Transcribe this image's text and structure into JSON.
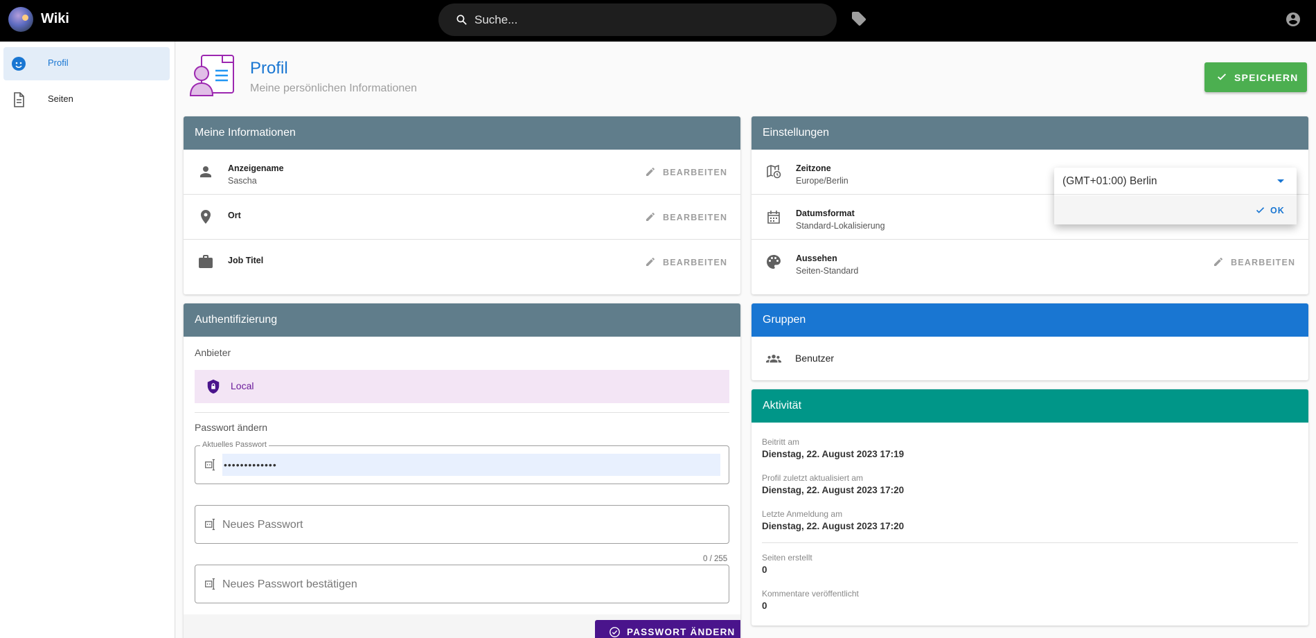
{
  "app": {
    "title": "Wiki"
  },
  "search": {
    "placeholder": "Suche..."
  },
  "sidebar": {
    "items": [
      {
        "label": "Profil",
        "icon": "face-icon",
        "active": true
      },
      {
        "label": "Seiten",
        "icon": "document-icon",
        "active": false
      }
    ]
  },
  "header": {
    "title": "Profil",
    "subtitle": "Meine persönlichen Informationen",
    "save_label": "SPEICHERN"
  },
  "info": {
    "title": "Meine Informationen",
    "edit_label": "BEARBEITEN",
    "rows": [
      {
        "label": "Anzeigename",
        "value": "Sascha",
        "icon": "person-icon"
      },
      {
        "label": "Ort",
        "value": "",
        "icon": "location-pin-icon"
      },
      {
        "label": "Job Titel",
        "value": "",
        "icon": "briefcase-icon"
      }
    ]
  },
  "auth": {
    "title": "Authentifizierung",
    "provider_label": "Anbieter",
    "provider_value": "Local",
    "change_label": "Passwort ändern",
    "current_legend": "Aktuelles Passwort",
    "current_value": "•••••••••••••",
    "new_placeholder": "Neues Passwort",
    "counter": "0 / 255",
    "confirm_placeholder": "Neues Passwort bestätigen",
    "button_label": "PASSWORT ÄNDERN"
  },
  "settings": {
    "title": "Einstellungen",
    "edit_label": "BEARBEITEN",
    "rows": [
      {
        "label": "Zeitzone",
        "value": "Europe/Berlin",
        "icon": "map-clock-icon"
      },
      {
        "label": "Datumsformat",
        "value": "Standard-Lokalisierung",
        "icon": "calendar-icon"
      },
      {
        "label": "Aussehen",
        "value": "Seiten-Standard",
        "icon": "palette-icon"
      }
    ],
    "timezone_popup": {
      "selected": "(GMT+01:00) Berlin",
      "ok_label": "OK"
    }
  },
  "groups": {
    "title": "Gruppen",
    "items": [
      {
        "label": "Benutzer",
        "icon": "people-icon"
      }
    ]
  },
  "activity": {
    "title": "Aktivität",
    "items": [
      {
        "label": "Beitritt am",
        "value": "Dienstag, 22. August 2023 17:19"
      },
      {
        "label": "Profil zuletzt aktualisiert am",
        "value": "Dienstag, 22. August 2023 17:20"
      },
      {
        "label": "Letzte Anmeldung am",
        "value": "Dienstag, 22. August 2023 17:20"
      },
      {
        "label": "Seiten erstellt",
        "value": "0"
      },
      {
        "label": "Kommentare veröffentlicht",
        "value": "0"
      }
    ]
  },
  "colors": {
    "topbar": "#000000",
    "primary": "#1976d2",
    "save_button": "#4caf50",
    "card_header_slate": "#607d8b",
    "groups_header": "#1976d2",
    "activity_header": "#009688",
    "password_button": "#4a148c",
    "provider_background": "#f3e5f5"
  }
}
